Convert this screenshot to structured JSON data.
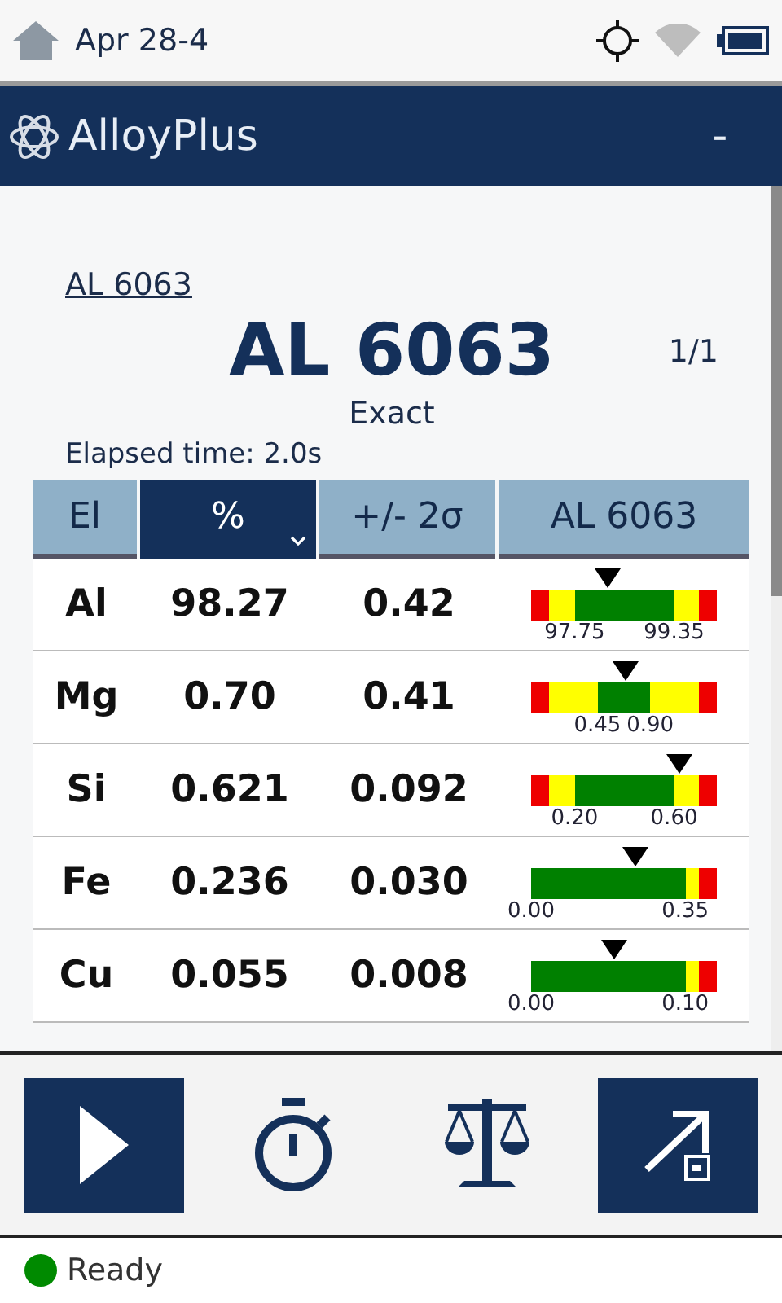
{
  "status_bar": {
    "title": "Apr 28-4"
  },
  "app_bar": {
    "title": "AlloyPlus",
    "action": "-"
  },
  "result": {
    "link": "AL 6063",
    "grade": "AL 6063",
    "count": "1/1",
    "match": "Exact",
    "elapsed": "Elapsed time: 2.0s"
  },
  "table": {
    "columns": [
      {
        "label": "El",
        "selected": false
      },
      {
        "label": "%",
        "selected": true
      },
      {
        "label": "+/- 2σ",
        "selected": false
      },
      {
        "label": "AL 6063",
        "selected": false
      }
    ],
    "rows": [
      {
        "element": "Al",
        "percent": "98.27",
        "error": "0.42",
        "low": "97.75",
        "high": "99.35",
        "level": 0.41,
        "kind": "wide",
        "segments": [
          {
            "color": "#ee0000"
          },
          {
            "color": "#ffff00"
          },
          {
            "color": "#008000"
          },
          {
            "color": "#ffff00"
          },
          {
            "color": "#ee0000"
          }
        ]
      },
      {
        "element": "Mg",
        "percent": "0.70",
        "error": "0.41",
        "low": "0.45",
        "high": "0.90",
        "level": 0.51,
        "kind": "narrow",
        "segments": [
          {
            "color": "#ee0000"
          },
          {
            "color": "#ffff00"
          },
          {
            "color": "#008000"
          },
          {
            "color": "#ffff00"
          },
          {
            "color": "#ee0000"
          }
        ]
      },
      {
        "element": "Si",
        "percent": "0.621",
        "error": "0.092",
        "low": "0.20",
        "high": "0.60",
        "level": 0.8,
        "kind": "wide",
        "segments": [
          {
            "color": "#ee0000"
          },
          {
            "color": "#ffff00"
          },
          {
            "color": "#008000"
          },
          {
            "color": "#ffff00"
          },
          {
            "color": "#ee0000"
          }
        ]
      },
      {
        "element": "Fe",
        "percent": "0.236",
        "error": "0.030",
        "low": "0.00",
        "high": "0.35",
        "level": 0.56,
        "kind": "upper",
        "segments": [
          {
            "color": "#008000"
          },
          {
            "color": "#ffff00"
          },
          {
            "color": "#ee0000"
          }
        ]
      },
      {
        "element": "Cu",
        "percent": "0.055",
        "error": "0.008",
        "low": "0.00",
        "high": "0.10",
        "level": 0.45,
        "kind": "upper",
        "segments": [
          {
            "color": "#008000"
          },
          {
            "color": "#ffff00"
          },
          {
            "color": "#ee0000"
          }
        ]
      }
    ]
  },
  "toolbar": [
    {
      "kind": "play",
      "filled": true
    },
    {
      "kind": "timer",
      "filled": false
    },
    {
      "kind": "scale",
      "filled": false
    },
    {
      "kind": "export",
      "filled": true
    }
  ],
  "footer": {
    "status": "Ready",
    "color": "#008a00"
  }
}
